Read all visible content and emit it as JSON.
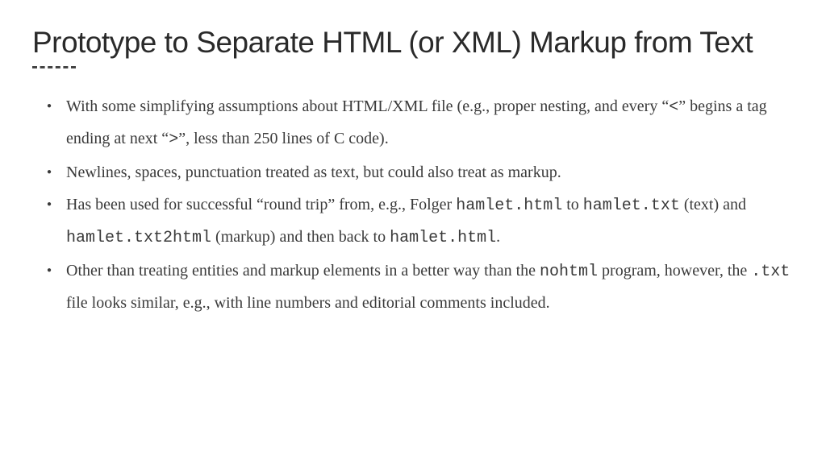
{
  "title": "Prototype to Separate HTML (or XML) Markup from Text",
  "bullets": {
    "b1_p1": "With some simplifying assumptions about HTML/XML file (e.g., proper nesting, and every “",
    "b1_lt": "<",
    "b1_p2": "” begins a tag ending at next “",
    "b1_gt": ">",
    "b1_p3": "”, less than 250 lines of C code).",
    "b2": "Newlines, spaces, punctuation treated as text, but could also treat as markup.",
    "b3_p1": "Has been used for successful “round trip” from, e.g., Folger ",
    "b3_m1": "hamlet.html",
    "b3_p2": " to ",
    "b3_m2": "hamlet.txt",
    "b3_p3": " (text) and ",
    "b3_m3": "hamlet.txt2html",
    "b3_p4": " (markup) and then back to ",
    "b3_m4": "hamlet.html",
    "b3_p5": ".",
    "b4_p1": "Other than treating entities and markup elements in a better way than the ",
    "b4_m1": "nohtml",
    "b4_p2": " program, however, the ",
    "b4_m2": ".txt",
    "b4_p3": " file looks similar, e.g., with line numbers and editorial comments included."
  }
}
